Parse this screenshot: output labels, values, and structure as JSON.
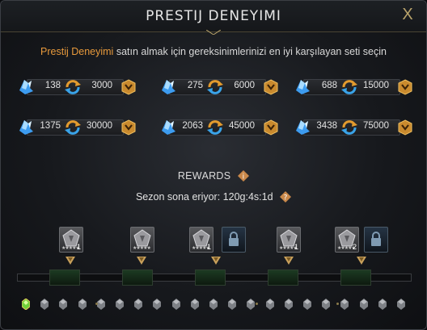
{
  "dialog": {
    "title": "PRESTIJ DENEYIMI",
    "close_label": "X"
  },
  "subtitle": {
    "accent": "Prestij Deneyimi",
    "rest": "satın almak için gereksinimlerinizi en iyi karşılayan seti seçin"
  },
  "bundles": [
    {
      "crystals": "138",
      "xp": "3000"
    },
    {
      "crystals": "275",
      "xp": "6000"
    },
    {
      "crystals": "688",
      "xp": "15000"
    },
    {
      "crystals": "1375",
      "xp": "30000"
    },
    {
      "crystals": "2063",
      "xp": "45000"
    },
    {
      "crystals": "3438",
      "xp": "75000"
    }
  ],
  "rewards": {
    "label": "REWARDS",
    "season_text": "Sezon sona eriyor: 120g:4s:1d",
    "slots": [
      {
        "count": "1",
        "stars": "★★★★★"
      },
      {
        "count": "",
        "stars": "★★★★★"
      },
      {
        "count": "1",
        "stars": "★★★★★"
      },
      {
        "count": "",
        "stars": ""
      },
      {
        "count": "1",
        "stars": "★★★★★"
      },
      {
        "count": "2",
        "stars": "★★★★★"
      },
      {
        "count": "",
        "stars": ""
      }
    ]
  },
  "colors": {
    "accent": "#e89a3c",
    "gold": "#b9a36b",
    "crystal": "#5fb8ff"
  }
}
